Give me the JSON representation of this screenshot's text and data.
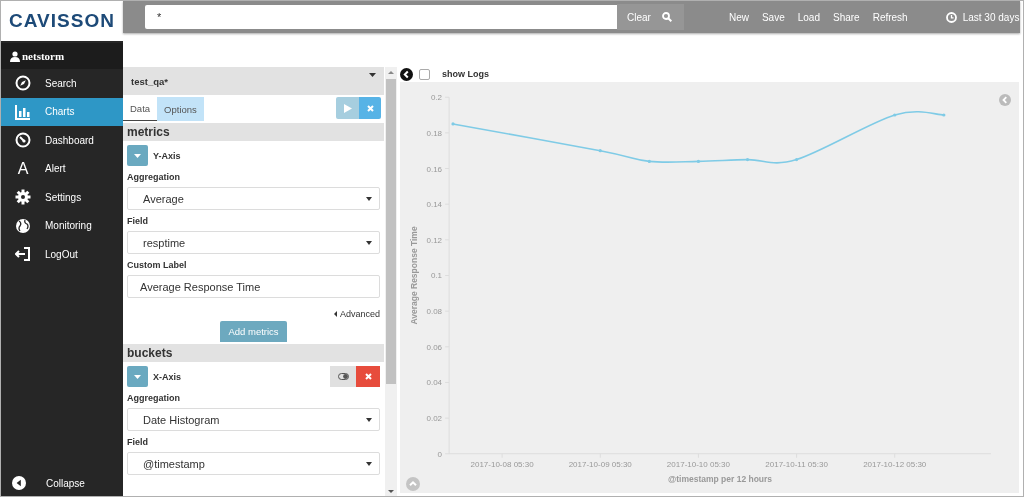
{
  "logo": {
    "text": "CAVISSON"
  },
  "top_bar": {
    "search": {
      "value": "*"
    },
    "clear_button": "Clear",
    "actions": [
      "New",
      "Save",
      "Load",
      "Share",
      "Refresh"
    ],
    "time_range": "Last 30 days"
  },
  "sidebar": {
    "user": "netstorm",
    "items": [
      {
        "label": "Search",
        "selected": false
      },
      {
        "label": "Charts",
        "selected": true
      },
      {
        "label": "Dashboard",
        "selected": false
      },
      {
        "label": "Alert",
        "selected": false,
        "glyph": "A"
      },
      {
        "label": "Settings",
        "selected": false
      },
      {
        "label": "Monitoring",
        "selected": false
      },
      {
        "label": "LogOut",
        "selected": false
      }
    ],
    "collapse": "Collapse"
  },
  "editor": {
    "title": "test_qa*",
    "tabs": [
      {
        "label": "Data",
        "selected": true
      },
      {
        "label": "Options",
        "selected": false
      }
    ],
    "sections": [
      {
        "title": "metrics",
        "axis": "Y-Axis",
        "removable": false,
        "fields": [
          {
            "kind": "select",
            "label": "Aggregation",
            "value": "Average"
          },
          {
            "kind": "select",
            "label": "Field",
            "value": "resptime"
          },
          {
            "kind": "input",
            "label": "Custom Label",
            "value": "Average Response Time"
          }
        ],
        "advanced": "Advanced",
        "add_button": "Add metrics"
      },
      {
        "title": "buckets",
        "axis": "X-Axis",
        "removable": true,
        "fields": [
          {
            "kind": "select",
            "label": "Aggregation",
            "value": "Date Histogram"
          },
          {
            "kind": "select",
            "label": "Field",
            "value": "@timestamp"
          }
        ]
      }
    ]
  },
  "visualization": {
    "show_logs": {
      "label": "show Logs",
      "checked": false
    },
    "chart_data": {
      "type": "line",
      "xlabel": "@timestamp per 12 hours",
      "ylabel": "Average Response Time",
      "categories": [
        null,
        "2017-10-08 05:30",
        null,
        "2017-10-09 05:30",
        null,
        "2017-10-10 05:30",
        null,
        "2017-10-11 05:30",
        null,
        "2017-10-12 05:30",
        null
      ],
      "series": [
        {
          "color": "#7fcbe6",
          "values": [
            0.185,
            null,
            null,
            0.17,
            0.164,
            0.164,
            0.165,
            0.165,
            null,
            0.19,
            0.19
          ]
        }
      ],
      "ylim": [
        0,
        0.2
      ],
      "yticks": [
        0,
        0.02,
        0.04,
        0.06,
        0.08,
        0.1,
        0.12,
        0.14,
        0.16,
        0.18,
        0.2
      ]
    }
  }
}
